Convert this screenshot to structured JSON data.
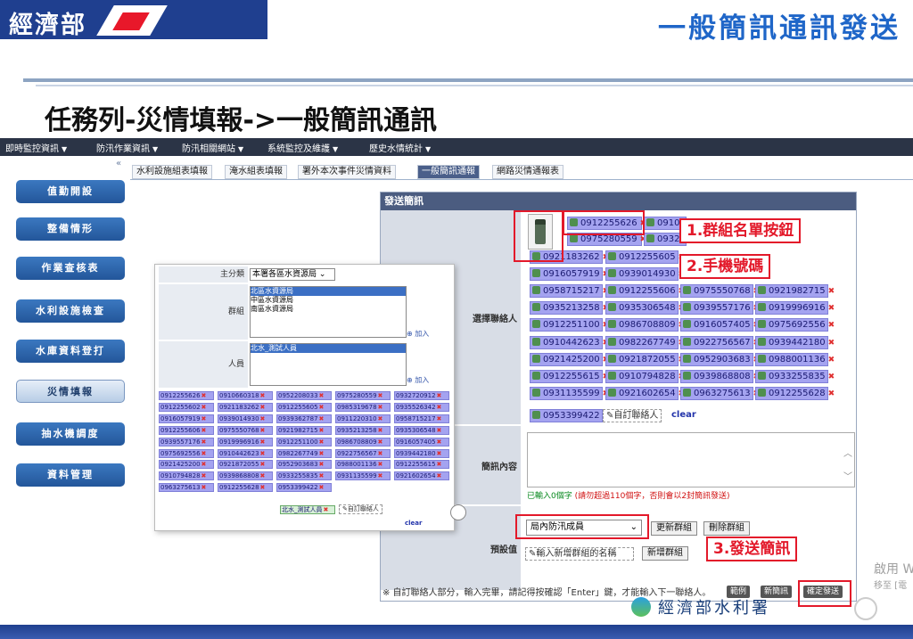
{
  "header": {
    "org": "經濟部",
    "slide_title": "一般簡訊通訊發送"
  },
  "task_title": "任務列-災情填報->一般簡訊通訊",
  "menu": [
    "即時監控資訊",
    "防汛作業資訊",
    "防汛相關網站",
    "系統監控及維護",
    "歷史水情統計"
  ],
  "sidebar": [
    "值勤開設",
    "整備情形",
    "作業查核表",
    "水利設施檢查",
    "水庫資料登打",
    "災情填報",
    "抽水機調度",
    "資料管理"
  ],
  "tabs": [
    "水利設施組表填報",
    "淹水組表填報",
    "署外本次事件災情資料",
    "一般簡訊通報",
    "網路災情通報表"
  ],
  "form": {
    "title": "發送簡訊",
    "select_contacts_label": "選擇聯絡人",
    "content_label": "簡訊內容",
    "preset_label": "預設值",
    "phones": [
      "0912255626",
      "0910",
      "0975280559",
      "0932",
      "0921183262",
      "0912255605",
      "0916057919",
      "0939014930",
      "0958715217",
      "0912255606",
      "0975550768",
      "0921982715",
      "0935213258",
      "0935306548",
      "0939557176",
      "0919996916",
      "0912251100",
      "0986708809",
      "0916057405",
      "0975692556",
      "0910442623",
      "0982267749",
      "0922756567",
      "0939442180",
      "0921425200",
      "0921872055",
      "0952903683",
      "0988001136",
      "0912255615",
      "0910794828",
      "0939868808",
      "0933255835",
      "0931135599",
      "0921602654",
      "0963275613",
      "0912255628",
      "0953399422"
    ],
    "custom_contact": "自訂聯絡人",
    "clear": "clear",
    "hint_prefix": "已輸入",
    "hint_count": "0",
    "hint_mid": "個字",
    "hint_red": "(請勿超過110個字，否則會以2封簡訊發送)",
    "group_select": "局內防汛成員",
    "update_group": "更新群組",
    "delete_group": "刪除群組",
    "new_group_placeholder": "輸入新增群組的名稱",
    "add_group": "新增群組",
    "note": "※ 自訂聯絡人部分，輸入完畢，請記得按確認「Enter」鍵，才能輸入下一聯絡人。",
    "btn_example": "範例",
    "btn_new": "新簡訊",
    "btn_send": "確定發送"
  },
  "callouts": {
    "c1": "1.群組名單按鈕",
    "c2": "2.手機號碼",
    "c3": "3.發送簡訊"
  },
  "popup": {
    "main_label": "主分類",
    "main_value": "本署各區水資源局",
    "group_label": "群組",
    "groups": [
      "北區水資源局",
      "中區水資源局",
      "南區水資源局"
    ],
    "person_label": "人員",
    "persons": [
      "北水_測試人員"
    ],
    "add": "加入",
    "chips": [
      "0912255626",
      "0910660318",
      "0952208033",
      "0975280559",
      "0932720912",
      "0912255602",
      "0921183262",
      "0912255605",
      "0985319678",
      "0935526342",
      "0916057919",
      "0939014930",
      "0939362787",
      "0911220310",
      "0958715217",
      "0912255606",
      "0975550768",
      "0921982715",
      "0935213258",
      "0935306548",
      "0939557176",
      "0919996916",
      "0912251100",
      "0986708809",
      "0916057405",
      "0975692556",
      "0910442623",
      "0982267749",
      "0922756567",
      "0939442180",
      "0921425200",
      "0921872055",
      "0952903683",
      "0988001136",
      "0912255615",
      "0910794828",
      "0939868808",
      "0933255835",
      "0931135599",
      "0921602654",
      "0963275613",
      "0912255628",
      "0953399422"
    ],
    "test_person": "北水_測試人員",
    "custom_contact": "自訂聯絡人",
    "clear": "clear"
  },
  "footer": {
    "logo": "經濟部水利署"
  },
  "watermark": {
    "line1": "啟用 W",
    "line2": "移至 [電"
  }
}
